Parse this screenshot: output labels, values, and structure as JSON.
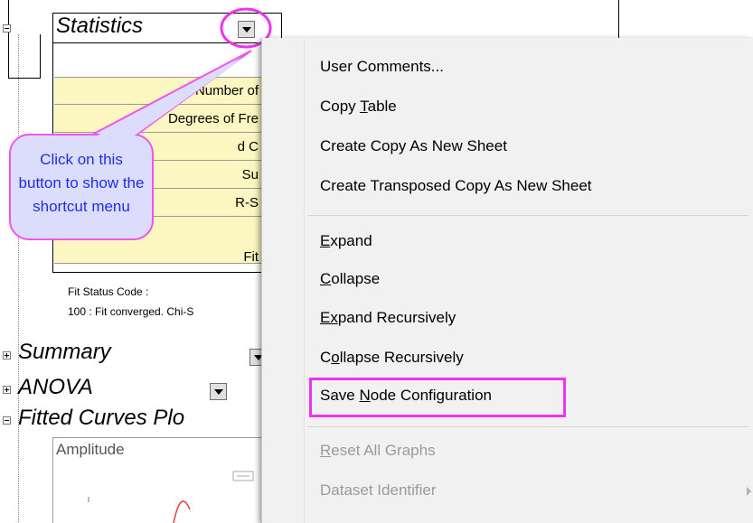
{
  "tree": {
    "statistics_title": "Statistics",
    "summary_title": "Summary",
    "anova_title": "ANOVA",
    "fitted_title": "Fitted Curves Plo",
    "plot_label": "Amplitude",
    "table_rows": [
      "Number of",
      "Degrees of Fre",
      "d C",
      "Su",
      "R-S",
      "Fit"
    ],
    "status_code_label": "Fit Status Code :",
    "status_code_value": "100 : Fit converged. Chi-S"
  },
  "callout": {
    "line1": "Click on this",
    "line2": "button to show the",
    "line3": "shortcut menu"
  },
  "menu": {
    "items": [
      {
        "pre": "",
        "key": "",
        "post": "User Comments...",
        "enabled": true
      },
      {
        "pre": "Copy ",
        "key": "T",
        "post": "able",
        "enabled": true
      },
      {
        "pre": "",
        "key": "",
        "post": "Create Copy As New Sheet",
        "enabled": true
      },
      {
        "pre": "",
        "key": "",
        "post": "Create Transposed Copy As New Sheet",
        "enabled": true
      },
      {
        "pre": "",
        "key": "E",
        "post": "xpand",
        "enabled": true
      },
      {
        "pre": "",
        "key": "C",
        "post": "ollapse",
        "enabled": true
      },
      {
        "pre": "",
        "key": "Ex",
        "post": "pand Recursively",
        "enabled": true
      },
      {
        "pre": "C",
        "key": "o",
        "post": "llapse Recursively",
        "enabled": true
      },
      {
        "pre": "Save ",
        "key": "N",
        "post": "ode Configuration",
        "enabled": true
      },
      {
        "pre": "",
        "key": "R",
        "post": "eset All Graphs",
        "enabled": false
      },
      {
        "pre": "",
        "key": "",
        "post": "Dataset Identifier",
        "enabled": false
      }
    ]
  },
  "colors": {
    "highlight": "#ee33ee",
    "callout_fill": "#dcdcfc",
    "callout_text": "#1c2fe8",
    "table_fill": "#fcf6c0"
  }
}
